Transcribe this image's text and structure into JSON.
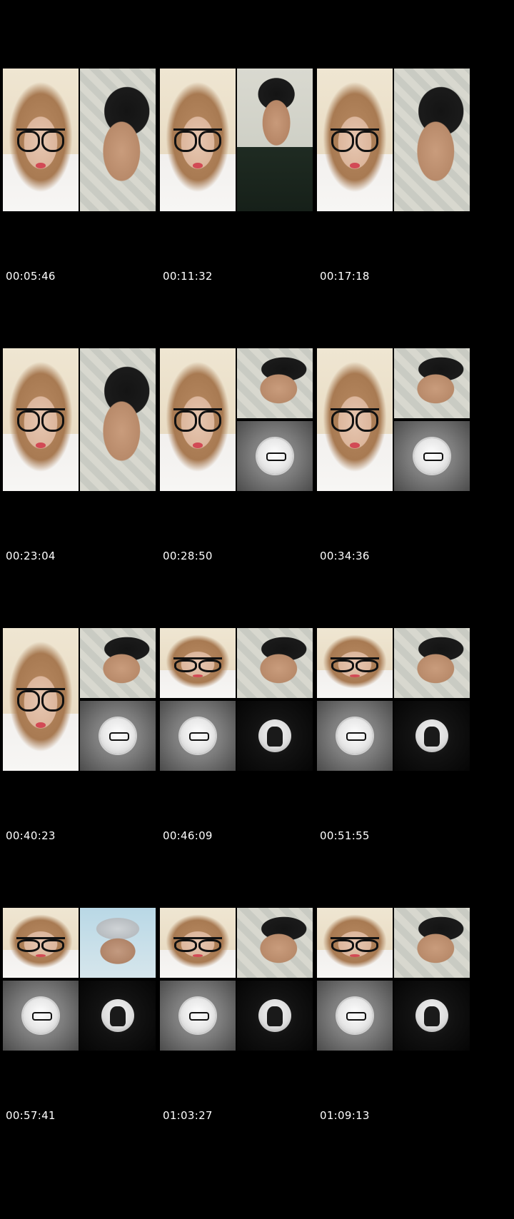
{
  "cells": [
    {
      "timestamp": "00:05:46",
      "layout": "split",
      "panes": [
        "girl",
        "guy"
      ]
    },
    {
      "timestamp": "00:11:32",
      "layout": "split",
      "panes": [
        "girl",
        "guy-dark"
      ]
    },
    {
      "timestamp": "00:17:18",
      "layout": "split",
      "panes": [
        "girl",
        "guy"
      ]
    },
    {
      "timestamp": "00:23:04",
      "layout": "split",
      "panes": [
        "girl",
        "guy"
      ]
    },
    {
      "timestamp": "00:28:50",
      "layout": "tri",
      "panes": [
        "girl",
        "guy",
        "avatar"
      ]
    },
    {
      "timestamp": "00:34:36",
      "layout": "tri",
      "panes": [
        "girl",
        "guy",
        "avatar"
      ]
    },
    {
      "timestamp": "00:40:23",
      "layout": "tri",
      "panes": [
        "girl",
        "guy",
        "avatar"
      ]
    },
    {
      "timestamp": "00:46:09",
      "layout": "quad",
      "panes": [
        "girl",
        "guy",
        "avatar",
        "dark"
      ]
    },
    {
      "timestamp": "00:51:55",
      "layout": "quad",
      "panes": [
        "girl",
        "guy",
        "avatar",
        "dark"
      ]
    },
    {
      "timestamp": "00:57:41",
      "layout": "quad",
      "panes": [
        "girl",
        "guy-blue",
        "avatar",
        "dark"
      ]
    },
    {
      "timestamp": "01:03:27",
      "layout": "quad",
      "panes": [
        "girl",
        "guy",
        "avatar",
        "dark"
      ]
    },
    {
      "timestamp": "01:09:13",
      "layout": "quad",
      "panes": [
        "girl",
        "guy",
        "avatar",
        "dark"
      ]
    }
  ]
}
